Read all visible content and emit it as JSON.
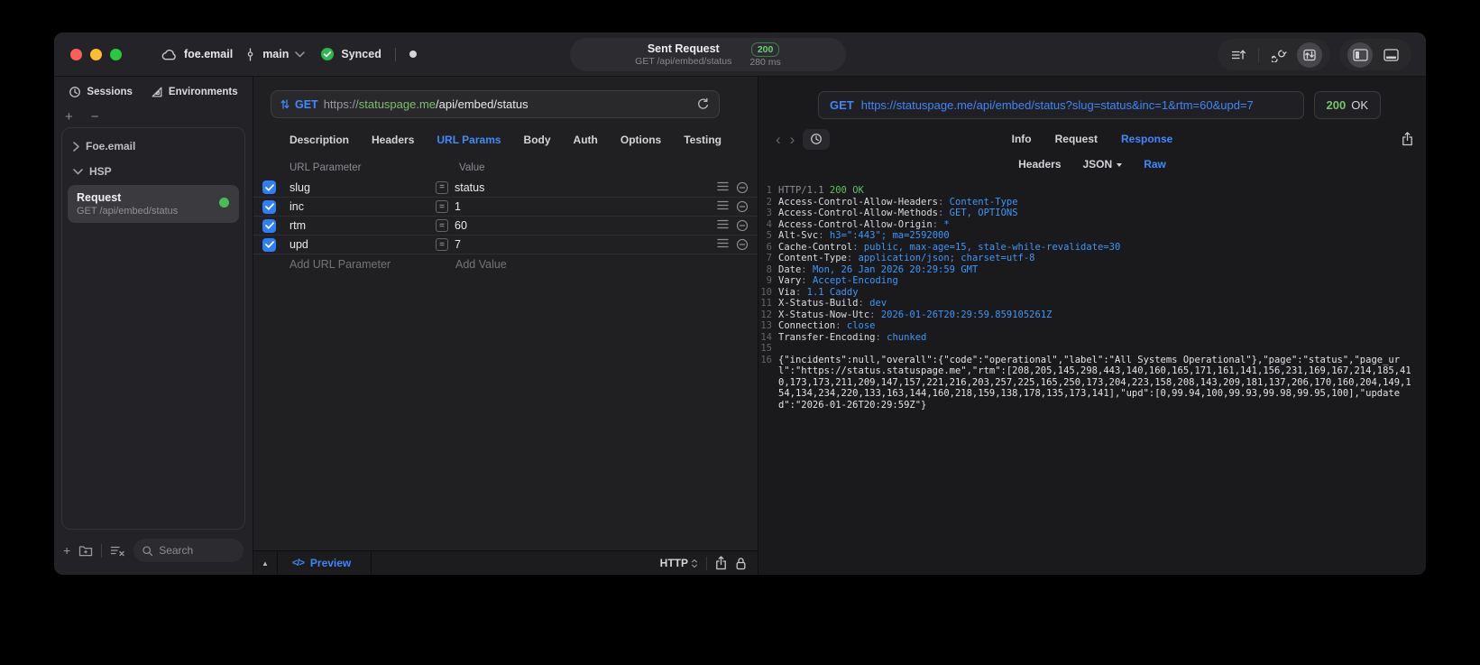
{
  "icons": {
    "plus": "+",
    "minus": "−",
    "collapse": "▲",
    "chev_left": "‹",
    "chev_right": "›",
    "equals": "=",
    "code_icon": "</>"
  },
  "titlebar": {
    "project": "foe.email",
    "branch": "main",
    "sync_label": "Synced",
    "request_title": "Sent Request",
    "request_subtitle": "GET /api/embed/status",
    "status_code": "200",
    "duration": "280 ms"
  },
  "sidebar": {
    "tabs": {
      "sessions": "Sessions",
      "environments": "Environments"
    },
    "tree": {
      "group1": "Foe.email",
      "group2": "HSP",
      "request_name": "Request",
      "request_subtitle": "GET /api/embed/status"
    },
    "search_placeholder": "Search"
  },
  "request_pane": {
    "method": "GET",
    "url": {
      "scheme": "https://",
      "host": "statuspage.me",
      "path": "/api/embed/status"
    },
    "tabs": [
      "Description",
      "Headers",
      "URL Params",
      "Body",
      "Auth",
      "Options",
      "Testing"
    ],
    "active_tab": "URL Params",
    "params": {
      "col_param": "URL Parameter",
      "col_value": "Value",
      "rows": [
        {
          "name": "slug",
          "value": "status",
          "enabled": true
        },
        {
          "name": "inc",
          "value": "1",
          "enabled": true
        },
        {
          "name": "rtm",
          "value": "60",
          "enabled": true
        },
        {
          "name": "upd",
          "value": "7",
          "enabled": true
        }
      ],
      "add_param": "Add URL Parameter",
      "add_value": "Add Value"
    },
    "footer": {
      "preview": "Preview",
      "protocol": "HTTP"
    }
  },
  "response_pane": {
    "method": "GET",
    "url": "https://statuspage.me/api/embed/status?slug=status&inc=1&rtm=60&upd=7",
    "status_code": "200",
    "status_text": "OK",
    "tabs": [
      "Info",
      "Request",
      "Response"
    ],
    "active_tab": "Response",
    "subtabs": [
      "Headers",
      "JSON",
      "Raw"
    ],
    "active_subtab": "Raw",
    "lines": [
      {
        "n": "1",
        "parts": [
          [
            "dim",
            "HTTP/1.1 "
          ],
          [
            "green",
            "200 OK"
          ]
        ]
      },
      {
        "n": "2",
        "parts": [
          [
            "name",
            "Access-Control-Allow-Headers"
          ],
          [
            "dim",
            ": "
          ],
          [
            "val",
            "Content-Type"
          ]
        ]
      },
      {
        "n": "3",
        "parts": [
          [
            "name",
            "Access-Control-Allow-Methods"
          ],
          [
            "dim",
            ": "
          ],
          [
            "val",
            "GET, OPTIONS"
          ]
        ]
      },
      {
        "n": "4",
        "parts": [
          [
            "name",
            "Access-Control-Allow-Origin"
          ],
          [
            "dim",
            ": "
          ],
          [
            "val",
            "*"
          ]
        ]
      },
      {
        "n": "5",
        "parts": [
          [
            "name",
            "Alt-Svc"
          ],
          [
            "dim",
            ": "
          ],
          [
            "val",
            "h3=\":443\"; ma=2592000"
          ]
        ]
      },
      {
        "n": "6",
        "parts": [
          [
            "name",
            "Cache-Control"
          ],
          [
            "dim",
            ": "
          ],
          [
            "val",
            "public, max-age=15, stale-while-revalidate=30"
          ]
        ]
      },
      {
        "n": "7",
        "parts": [
          [
            "name",
            "Content-Type"
          ],
          [
            "dim",
            ": "
          ],
          [
            "val",
            "application/json; charset=utf-8"
          ]
        ]
      },
      {
        "n": "8",
        "parts": [
          [
            "name",
            "Date"
          ],
          [
            "dim",
            ": "
          ],
          [
            "val",
            "Mon, 26 Jan 2026 20:29:59 GMT"
          ]
        ]
      },
      {
        "n": "9",
        "parts": [
          [
            "name",
            "Vary"
          ],
          [
            "dim",
            ": "
          ],
          [
            "val",
            "Accept-Encoding"
          ]
        ]
      },
      {
        "n": "10",
        "parts": [
          [
            "name",
            "Via"
          ],
          [
            "dim",
            ": "
          ],
          [
            "val",
            "1.1 Caddy"
          ]
        ]
      },
      {
        "n": "11",
        "parts": [
          [
            "name",
            "X-Status-Build"
          ],
          [
            "dim",
            ": "
          ],
          [
            "val",
            "dev"
          ]
        ]
      },
      {
        "n": "12",
        "parts": [
          [
            "name",
            "X-Status-Now-Utc"
          ],
          [
            "dim",
            ": "
          ],
          [
            "val",
            "2026-01-26T20:29:59.859105261Z"
          ]
        ]
      },
      {
        "n": "13",
        "parts": [
          [
            "name",
            "Connection"
          ],
          [
            "dim",
            ": "
          ],
          [
            "val",
            "close"
          ]
        ]
      },
      {
        "n": "14",
        "parts": [
          [
            "name",
            "Transfer-Encoding"
          ],
          [
            "dim",
            ": "
          ],
          [
            "val",
            "chunked"
          ]
        ]
      },
      {
        "n": "15",
        "parts": []
      },
      {
        "n": "16",
        "parts": [
          [
            "plain",
            "{\"incidents\":null,\"overall\":{\"code\":\"operational\",\"label\":\"All Systems Operational\"},\"page\":\"status\",\"page_url\":\"https://status.statuspage.me\",\"rtm\":[208,205,145,298,443,140,160,165,171,161,141,156,231,169,167,214,185,410,173,173,211,209,147,157,221,216,203,257,225,165,250,173,204,223,158,208,143,209,181,137,206,170,160,204,149,154,134,234,220,133,163,144,160,218,159,138,178,135,173,141],\"upd\":[0,99.94,100,99.93,99.98,99.95,100],\"updated\":\"2026-01-26T20:29:59Z\"}"
          ]
        ]
      }
    ]
  },
  "colors": {
    "accent": "#4189fd",
    "green": "#5fbe66",
    "checkbox_blue": "#2e7ef7",
    "status_green": "#74c56c"
  }
}
